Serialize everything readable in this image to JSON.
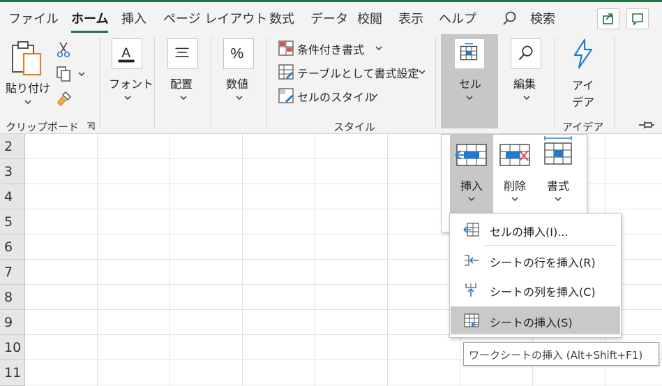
{
  "tabs": [
    "ファイル",
    "ホーム",
    "挿入",
    "ページ レイアウト",
    "数式",
    "データ",
    "校閲",
    "表示",
    "ヘルプ",
    "検索"
  ],
  "active_tab": "ホーム",
  "clipboard": {
    "paste_label": "貼り付け",
    "group_label": "クリップボード"
  },
  "ribbon": {
    "font_label": "フォント",
    "align_label": "配置",
    "number_label": "数値",
    "cond_format_label": "条件付き書式",
    "table_format_label": "テーブルとして書式設定",
    "cell_style_label": "セルのスタイル",
    "style_group_label": "スタイル",
    "cells_label": "セル",
    "edit_label": "編集",
    "ideas_label_1": "アイ",
    "ideas_label_2": "デア",
    "ideas_group_label": "アイデア"
  },
  "cells_panel": {
    "insert_label": "挿入",
    "delete_label": "削除",
    "format_label": "書式"
  },
  "menu": {
    "items": [
      "セルの挿入(I)...",
      "シートの行を挿入(R)",
      "シートの列を挿入(C)",
      "シートの挿入(S)"
    ],
    "hover_index": 3
  },
  "tooltip": "ワークシートの挿入 (Alt+Shift+F1)",
  "rows": [
    "2",
    "3",
    "4",
    "5",
    "6",
    "7",
    "8",
    "9",
    "10",
    "11"
  ],
  "colors": {
    "accent": "#217346",
    "ribbon_bg": "#f3f3f3",
    "icon_blue": "#1e7bd4"
  },
  "icons": [
    "search-icon",
    "share-icon",
    "comment-icon",
    "paste-icon",
    "cut-icon",
    "copy-icon",
    "format-painter-icon",
    "font-icon",
    "align-icon",
    "percent-icon",
    "cond-format-icon",
    "table-format-icon",
    "cell-style-icon",
    "cells-icon",
    "find-icon",
    "ideas-icon",
    "pin-icon"
  ]
}
